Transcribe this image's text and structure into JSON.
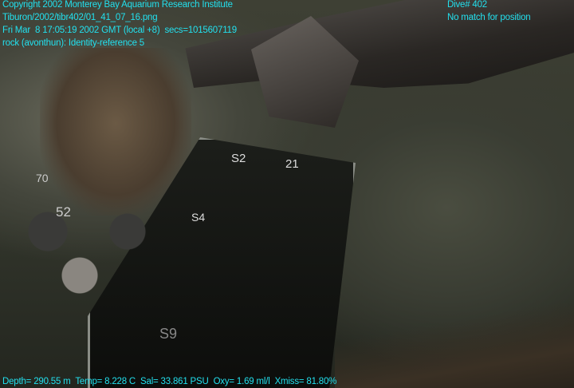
{
  "overlay": {
    "top_left": [
      "Copyright 2002 Monterey Bay Aquarium Research Institute",
      "Tiburon/2002/tibr402/01_41_07_16.png",
      "Fri Mar  8 17:05:19 2002 GMT (local +8)  secs=1015607119",
      "rock (avonthun): Identity-reference 5"
    ],
    "top_right": [
      "Dive# 402",
      "No match for position"
    ],
    "bottom": "Depth= 290.55 m  Temp= 8.228 C  Sal= 33.861 PSU  Oxy= 1.69 ml/l  Xmiss= 81.80%"
  },
  "scene_labels": {
    "box_labels": [
      "S2",
      "21",
      "S4",
      "S9"
    ],
    "jar_labels": [
      "70",
      "52"
    ]
  },
  "colors": {
    "overlay_text": "#22e0ee"
  }
}
